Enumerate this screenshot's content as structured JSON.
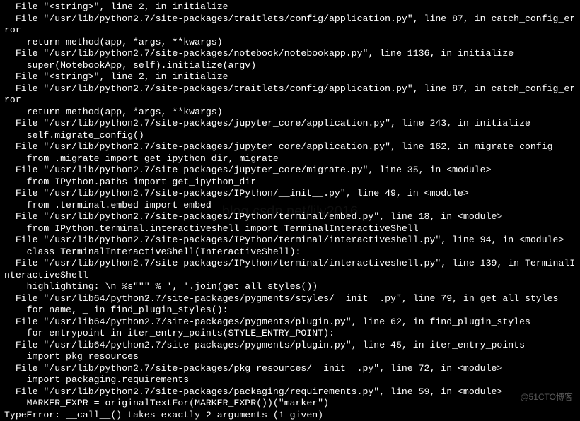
{
  "terminal": {
    "lines": [
      "  File \"<string>\", line 2, in initialize",
      "  File \"/usr/lib/python2.7/site-packages/traitlets/config/application.py\", line 87, in catch_config_error",
      "    return method(app, *args, **kwargs)",
      "  File \"/usr/lib/python2.7/site-packages/notebook/notebookapp.py\", line 1136, in initialize",
      "    super(NotebookApp, self).initialize(argv)",
      "  File \"<string>\", line 2, in initialize",
      "  File \"/usr/lib/python2.7/site-packages/traitlets/config/application.py\", line 87, in catch_config_error",
      "    return method(app, *args, **kwargs)",
      "  File \"/usr/lib/python2.7/site-packages/jupyter_core/application.py\", line 243, in initialize",
      "    self.migrate_config()",
      "  File \"/usr/lib/python2.7/site-packages/jupyter_core/application.py\", line 162, in migrate_config",
      "    from .migrate import get_ipython_dir, migrate",
      "  File \"/usr/lib/python2.7/site-packages/jupyter_core/migrate.py\", line 35, in <module>",
      "    from IPython.paths import get_ipython_dir",
      "  File \"/usr/lib/python2.7/site-packages/IPython/__init__.py\", line 49, in <module>",
      "    from .terminal.embed import embed",
      "  File \"/usr/lib/python2.7/site-packages/IPython/terminal/embed.py\", line 18, in <module>",
      "    from IPython.terminal.interactiveshell import TerminalInteractiveShell",
      "  File \"/usr/lib/python2.7/site-packages/IPython/terminal/interactiveshell.py\", line 94, in <module>",
      "    class TerminalInteractiveShell(InteractiveShell):",
      "  File \"/usr/lib/python2.7/site-packages/IPython/terminal/interactiveshell.py\", line 139, in TerminalInteractiveShell",
      "    highlighting: \\n %s\"\"\" % ', '.join(get_all_styles())",
      "  File \"/usr/lib64/python2.7/site-packages/pygments/styles/__init__.py\", line 79, in get_all_styles",
      "    for name, _ in find_plugin_styles():",
      "  File \"/usr/lib64/python2.7/site-packages/pygments/plugin.py\", line 62, in find_plugin_styles",
      "    for entrypoint in iter_entry_points(STYLE_ENTRY_POINT):",
      "  File \"/usr/lib64/python2.7/site-packages/pygments/plugin.py\", line 45, in iter_entry_points",
      "    import pkg_resources",
      "  File \"/usr/lib/python2.7/site-packages/pkg_resources/__init__.py\", line 72, in <module>",
      "    import packaging.requirements",
      "  File \"/usr/lib/python2.7/site-packages/packaging/requirements.py\", line 59, in <module>",
      "    MARKER_EXPR = originalTextFor(MARKER_EXPR())(\"marker\")",
      "TypeError: __call__() takes exactly 2 arguments (1 given)"
    ]
  },
  "watermark": "@51CTO博客",
  "ghost": "blog.csdn.net/lily2016"
}
